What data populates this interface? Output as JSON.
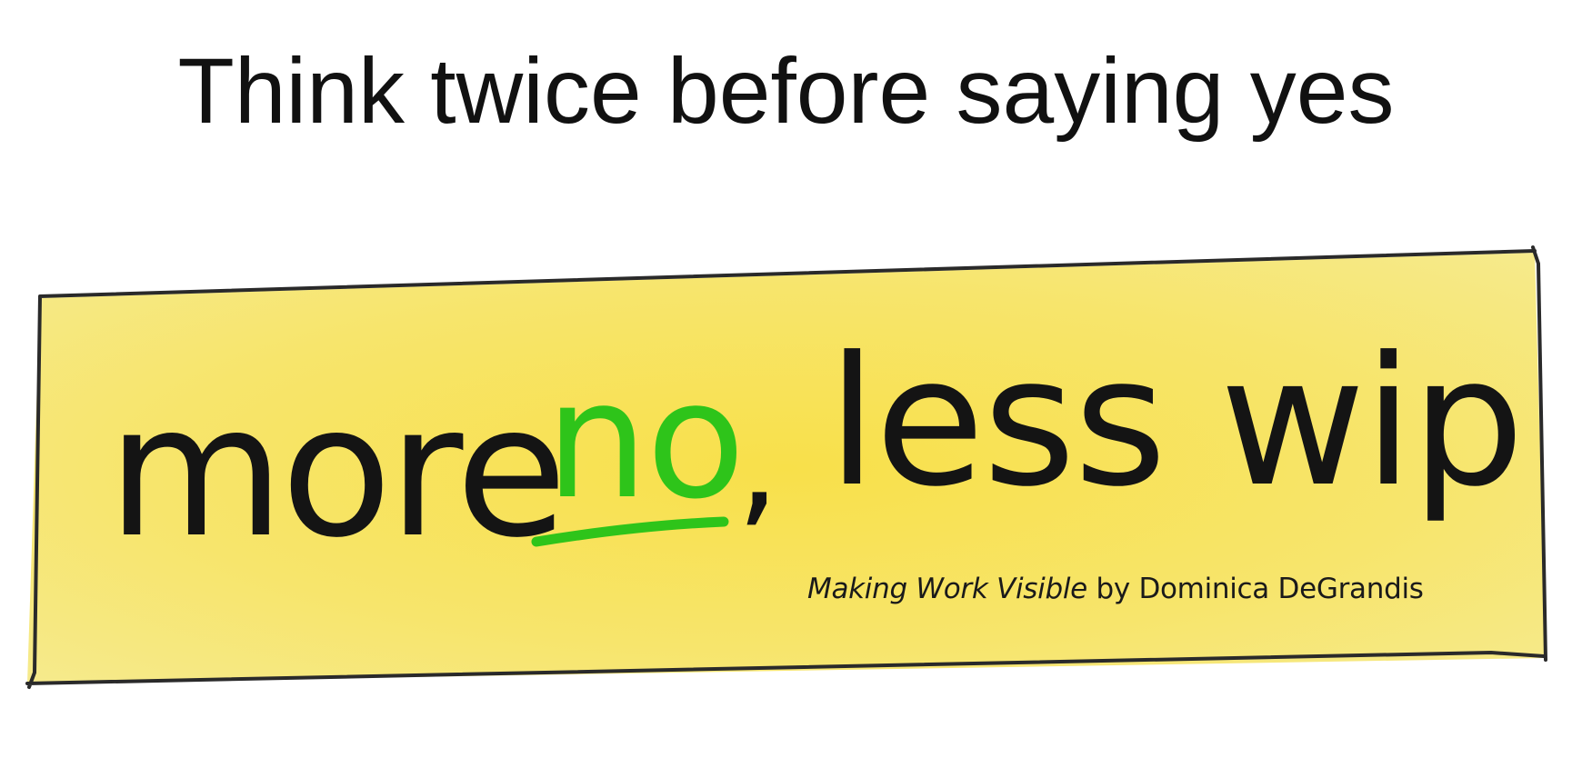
{
  "slide": {
    "title": "Think twice before saying yes"
  },
  "banner": {
    "slogan_part1": "more",
    "slogan_highlight": "no",
    "slogan_comma": ",",
    "slogan_part2": "less wip",
    "credit_book": "Making Work Visible",
    "credit_rest": " by Dominica DeGrandis"
  },
  "colors": {
    "banner_fill": "#f7e66a",
    "banner_border": "#2a2a2a",
    "slogan_text": "#141414",
    "slogan_highlight": "#2ec41a"
  }
}
